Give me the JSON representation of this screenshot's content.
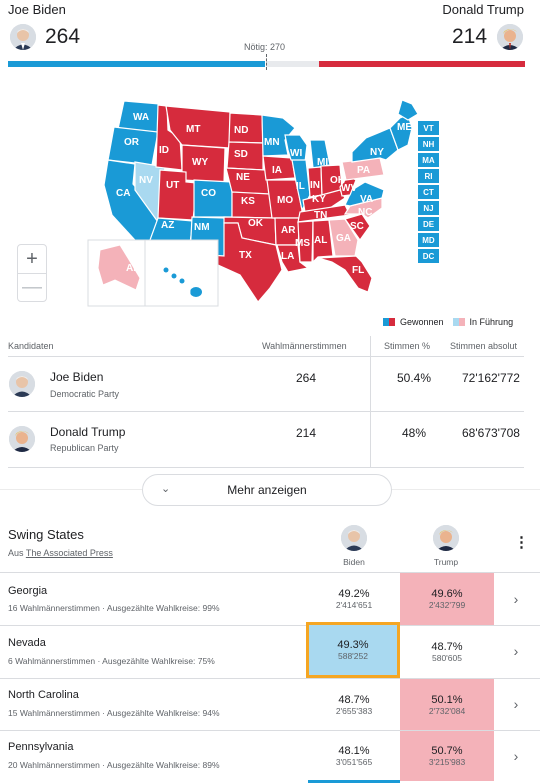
{
  "header": {
    "biden_name": "Joe Biden",
    "trump_name": "Donald Trump",
    "biden_votes": "264",
    "trump_votes": "214",
    "needed": "Nötig: 270"
  },
  "colors": {
    "biden_blue": "#1a9ad6",
    "trump_red": "#d62b3d",
    "lead_blue": "#a9d9f0",
    "lead_red": "#f4b2b9",
    "highlight": "#f5a623"
  },
  "map": {
    "states": {
      "WA": "WA",
      "OR": "OR",
      "CA": "CA",
      "NV": "NV",
      "ID": "ID",
      "MT": "MT",
      "WY": "WY",
      "UT": "UT",
      "CO": "CO",
      "AZ": "AZ",
      "NM": "NM",
      "ND": "ND",
      "SD": "SD",
      "NE": "NE",
      "KS": "KS",
      "OK": "OK",
      "TX": "TX",
      "MN": "MN",
      "IA": "IA",
      "MO": "MO",
      "AR": "AR",
      "LA": "LA",
      "WI": "WI",
      "IL": "IL",
      "MI": "MI",
      "IN": "IN",
      "OH": "OH",
      "KY": "KY",
      "TN": "TN",
      "MS": "MS",
      "AL": "AL",
      "GA": "GA",
      "FL": "FL",
      "SC": "SC",
      "NC": "NC",
      "VA": "VA",
      "WV": "WV",
      "PA": "PA",
      "NY": "NY",
      "ME": "ME",
      "AK": "AK",
      "HI": "HI"
    },
    "ne_squares": [
      "VT",
      "NH",
      "MA",
      "RI",
      "CT",
      "NJ",
      "DE",
      "MD",
      "DC"
    ],
    "zoom_in": "+",
    "zoom_out": "—",
    "legend_won": "Gewonnen",
    "legend_leading": "In Führung"
  },
  "table": {
    "headers": {
      "candidates": "Kandidaten",
      "electors": "Wahlmännerstimmen",
      "pct": "Stimmen %",
      "absolute": "Stimmen absolut"
    },
    "rows": [
      {
        "name": "Joe Biden",
        "party": "Democratic Party",
        "electors": "264",
        "pct": "50.4%",
        "absolute": "72'162'772"
      },
      {
        "name": "Donald Trump",
        "party": "Republican Party",
        "electors": "214",
        "pct": "48%",
        "absolute": "68'673'708"
      }
    ],
    "more": "Mehr anzeigen"
  },
  "swing": {
    "title": "Swing States",
    "source_prefix": "Aus",
    "source_link": "The Associated Press",
    "col_biden": "Biden",
    "col_trump": "Trump",
    "states": [
      {
        "name": "Georgia",
        "electors": "16 Wahlmännerstimmen",
        "counted": "Ausgezählte Wahlkreise: 99%",
        "biden_pct": "49.2%",
        "biden_abs": "2'414'651",
        "trump_pct": "49.6%",
        "trump_abs": "2'432'799"
      },
      {
        "name": "Nevada",
        "electors": "6 Wahlmännerstimmen",
        "counted": "Ausgezählte Wahlkreise: 75%",
        "biden_pct": "49.3%",
        "biden_abs": "588'252",
        "trump_pct": "48.7%",
        "trump_abs": "580'605"
      },
      {
        "name": "North Carolina",
        "electors": "15 Wahlmännerstimmen",
        "counted": "Ausgezählte Wahlkreise: 94%",
        "biden_pct": "48.7%",
        "biden_abs": "2'655'383",
        "trump_pct": "50.1%",
        "trump_abs": "2'732'084"
      },
      {
        "name": "Pennsylvania",
        "electors": "20 Wahlmännerstimmen",
        "counted": "Ausgezählte Wahlkreise: 89%",
        "biden_pct": "48.1%",
        "biden_abs": "3'051'565",
        "trump_pct": "50.7%",
        "trump_abs": "3'215'983"
      }
    ]
  }
}
